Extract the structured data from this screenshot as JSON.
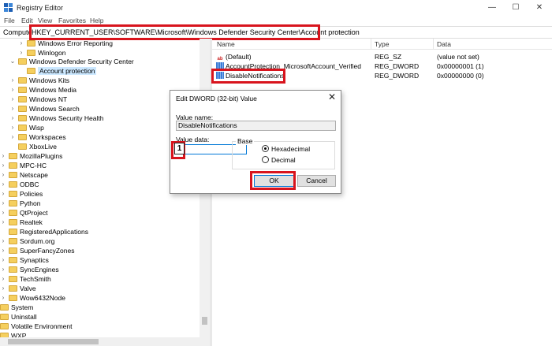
{
  "window": {
    "title": "Registry Editor",
    "controls": {
      "minimize": "—",
      "maximize": "☐",
      "close": "✕"
    }
  },
  "menu": [
    "File",
    "Edit",
    "View",
    "Favorites",
    "Help"
  ],
  "address": {
    "prefix": "Compute",
    "path": "HKEY_CURRENT_USER\\SOFTWARE\\Microsoft\\Windows Defender Security Center\\Account protection"
  },
  "tree": {
    "items": [
      {
        "label": "Windows Error Reporting",
        "expand": "›"
      },
      {
        "label": "Winlogon",
        "expand": "›"
      },
      {
        "label": "Windows Defender Security Center",
        "expand": "⌄"
      },
      {
        "label": "Account protection",
        "expand": ""
      },
      {
        "label": "Windows Kits",
        "expand": "›"
      },
      {
        "label": "Windows Media",
        "expand": "›"
      },
      {
        "label": "Windows NT",
        "expand": "›"
      },
      {
        "label": "Windows Search",
        "expand": "›"
      },
      {
        "label": "Windows Security Health",
        "expand": "›"
      },
      {
        "label": "Wisp",
        "expand": "›"
      },
      {
        "label": "Workspaces",
        "expand": "›"
      },
      {
        "label": "XboxLive",
        "expand": ""
      },
      {
        "label": "MozillaPlugins",
        "expand": "›"
      },
      {
        "label": "MPC-HC",
        "expand": "›"
      },
      {
        "label": "Netscape",
        "expand": "›"
      },
      {
        "label": "ODBC",
        "expand": "›"
      },
      {
        "label": "Policies",
        "expand": "›"
      },
      {
        "label": "Python",
        "expand": "›"
      },
      {
        "label": "QtProject",
        "expand": "›"
      },
      {
        "label": "Realtek",
        "expand": "›"
      },
      {
        "label": "RegisteredApplications",
        "expand": ""
      },
      {
        "label": "Sordum.org",
        "expand": "›"
      },
      {
        "label": "SuperFancyZones",
        "expand": "›"
      },
      {
        "label": "Synaptics",
        "expand": "›"
      },
      {
        "label": "SyncEngines",
        "expand": "›"
      },
      {
        "label": "TechSmith",
        "expand": "›"
      },
      {
        "label": "Valve",
        "expand": "›"
      },
      {
        "label": "Wow6432Node",
        "expand": "›"
      },
      {
        "label": "System",
        "expand": "›"
      },
      {
        "label": "Uninstall",
        "expand": "›"
      },
      {
        "label": "Volatile Environment",
        "expand": "›"
      },
      {
        "label": "WXP",
        "expand": "›"
      }
    ]
  },
  "list": {
    "columns": [
      "Name",
      "Type",
      "Data"
    ],
    "rows": [
      {
        "name": "(Default)",
        "type": "REG_SZ",
        "data": "(value not set)",
        "icon": "ab-icon"
      },
      {
        "name": "AccountProtection_MicrosoftAccount_Verified",
        "type": "REG_DWORD",
        "data": "0x00000001 (1)",
        "icon": "binary-icon"
      },
      {
        "name": "DisableNotifications",
        "type": "REG_DWORD",
        "data": "0x00000000 (0)",
        "icon": "binary-icon"
      }
    ]
  },
  "dialog": {
    "title": "Edit DWORD (32-bit) Value",
    "close": "✕",
    "value_name_label": "Value name:",
    "value_name": "DisableNotifications",
    "value_data_label": "Value data:",
    "value_data": "",
    "base_label": "Base",
    "hex_label": "Hexadecimal",
    "dec_label": "Decimal",
    "selected_base": "Hexadecimal",
    "ok_label": "OK",
    "cancel_label": "Cancel"
  },
  "annotation": {
    "step": "1"
  },
  "colors": {
    "highlight": "#d8141d",
    "selection": "#cce8ff",
    "accent": "#0078d7"
  }
}
